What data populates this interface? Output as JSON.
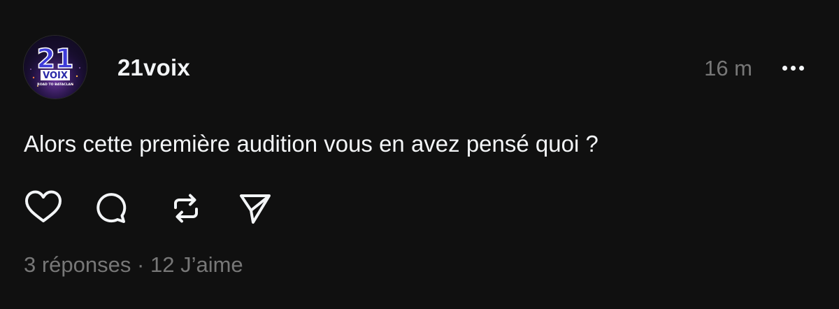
{
  "post": {
    "author": {
      "username": "21voix",
      "avatar_text": {
        "number": "21",
        "name": "VOIX",
        "tagline": "ROAD TO BATACLAN"
      }
    },
    "timestamp": "16 m",
    "text": "Alors cette première audition vous en avez pensé quoi ?",
    "actions": {
      "like_icon": "heart-icon",
      "reply_icon": "speech-bubble-icon",
      "repost_icon": "repost-icon",
      "share_icon": "send-icon"
    },
    "stats": {
      "replies": "3 réponses",
      "separator": "·",
      "likes": "12 J’aime"
    }
  },
  "colors": {
    "background": "#101010",
    "primary_text": "#f3f5f7",
    "secondary_text": "#777777"
  }
}
